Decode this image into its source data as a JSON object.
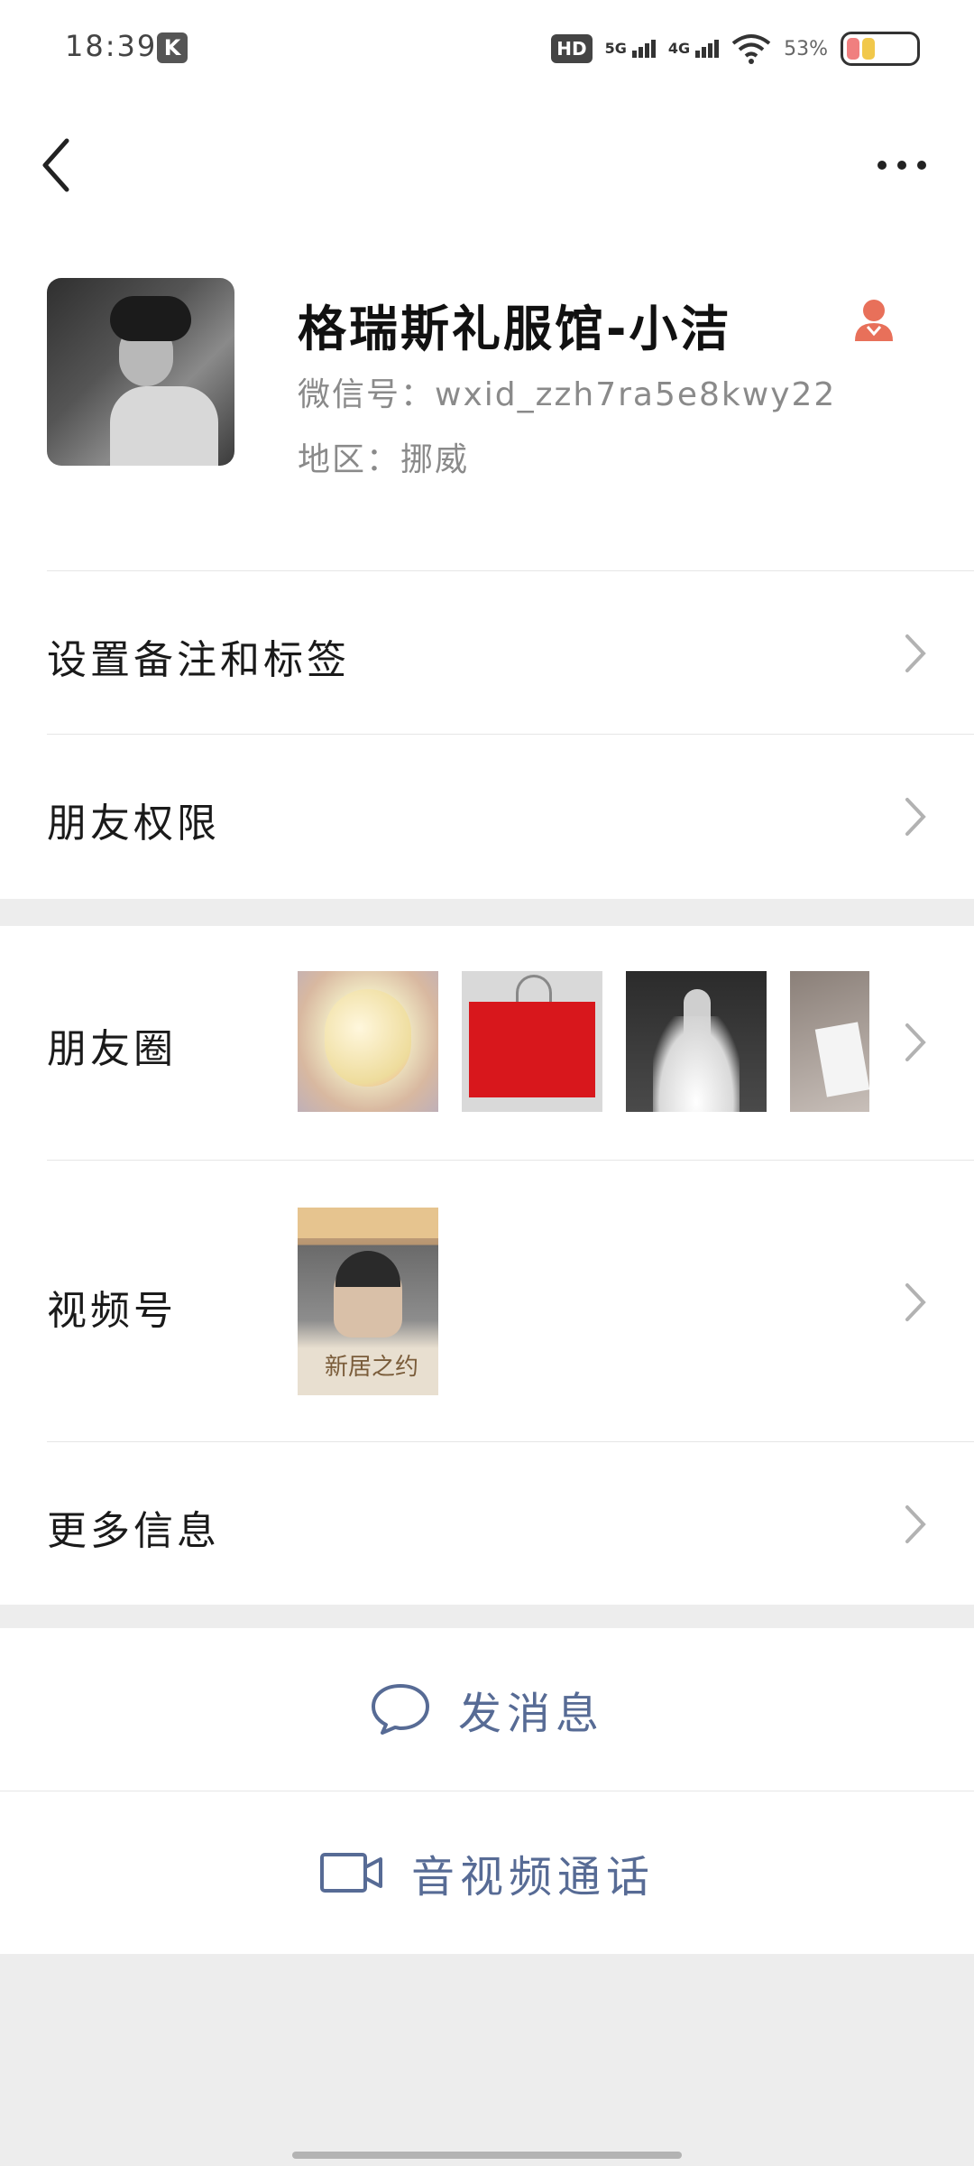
{
  "status_bar": {
    "time": "18:39",
    "app_badge": "K",
    "hd_label": "HD",
    "network1": "5G",
    "network2": "4G",
    "battery_percent": "53%"
  },
  "profile": {
    "name": "格瑞斯礼服馆-小洁",
    "wechat_id": "微信号：wxid_zzh7ra5e8kwy22",
    "region": "地区：挪威",
    "gender_icon": "female-icon",
    "gender_color": "#e8705a"
  },
  "rows": {
    "remark": "设置备注和标签",
    "permissions": "朋友权限",
    "moments": "朋友圈",
    "channels": "视频号",
    "more_info": "更多信息"
  },
  "video_thumb_caption": "新居之约",
  "actions": {
    "message": "发消息",
    "call": "音视频通话",
    "accent_color": "#576b95"
  }
}
